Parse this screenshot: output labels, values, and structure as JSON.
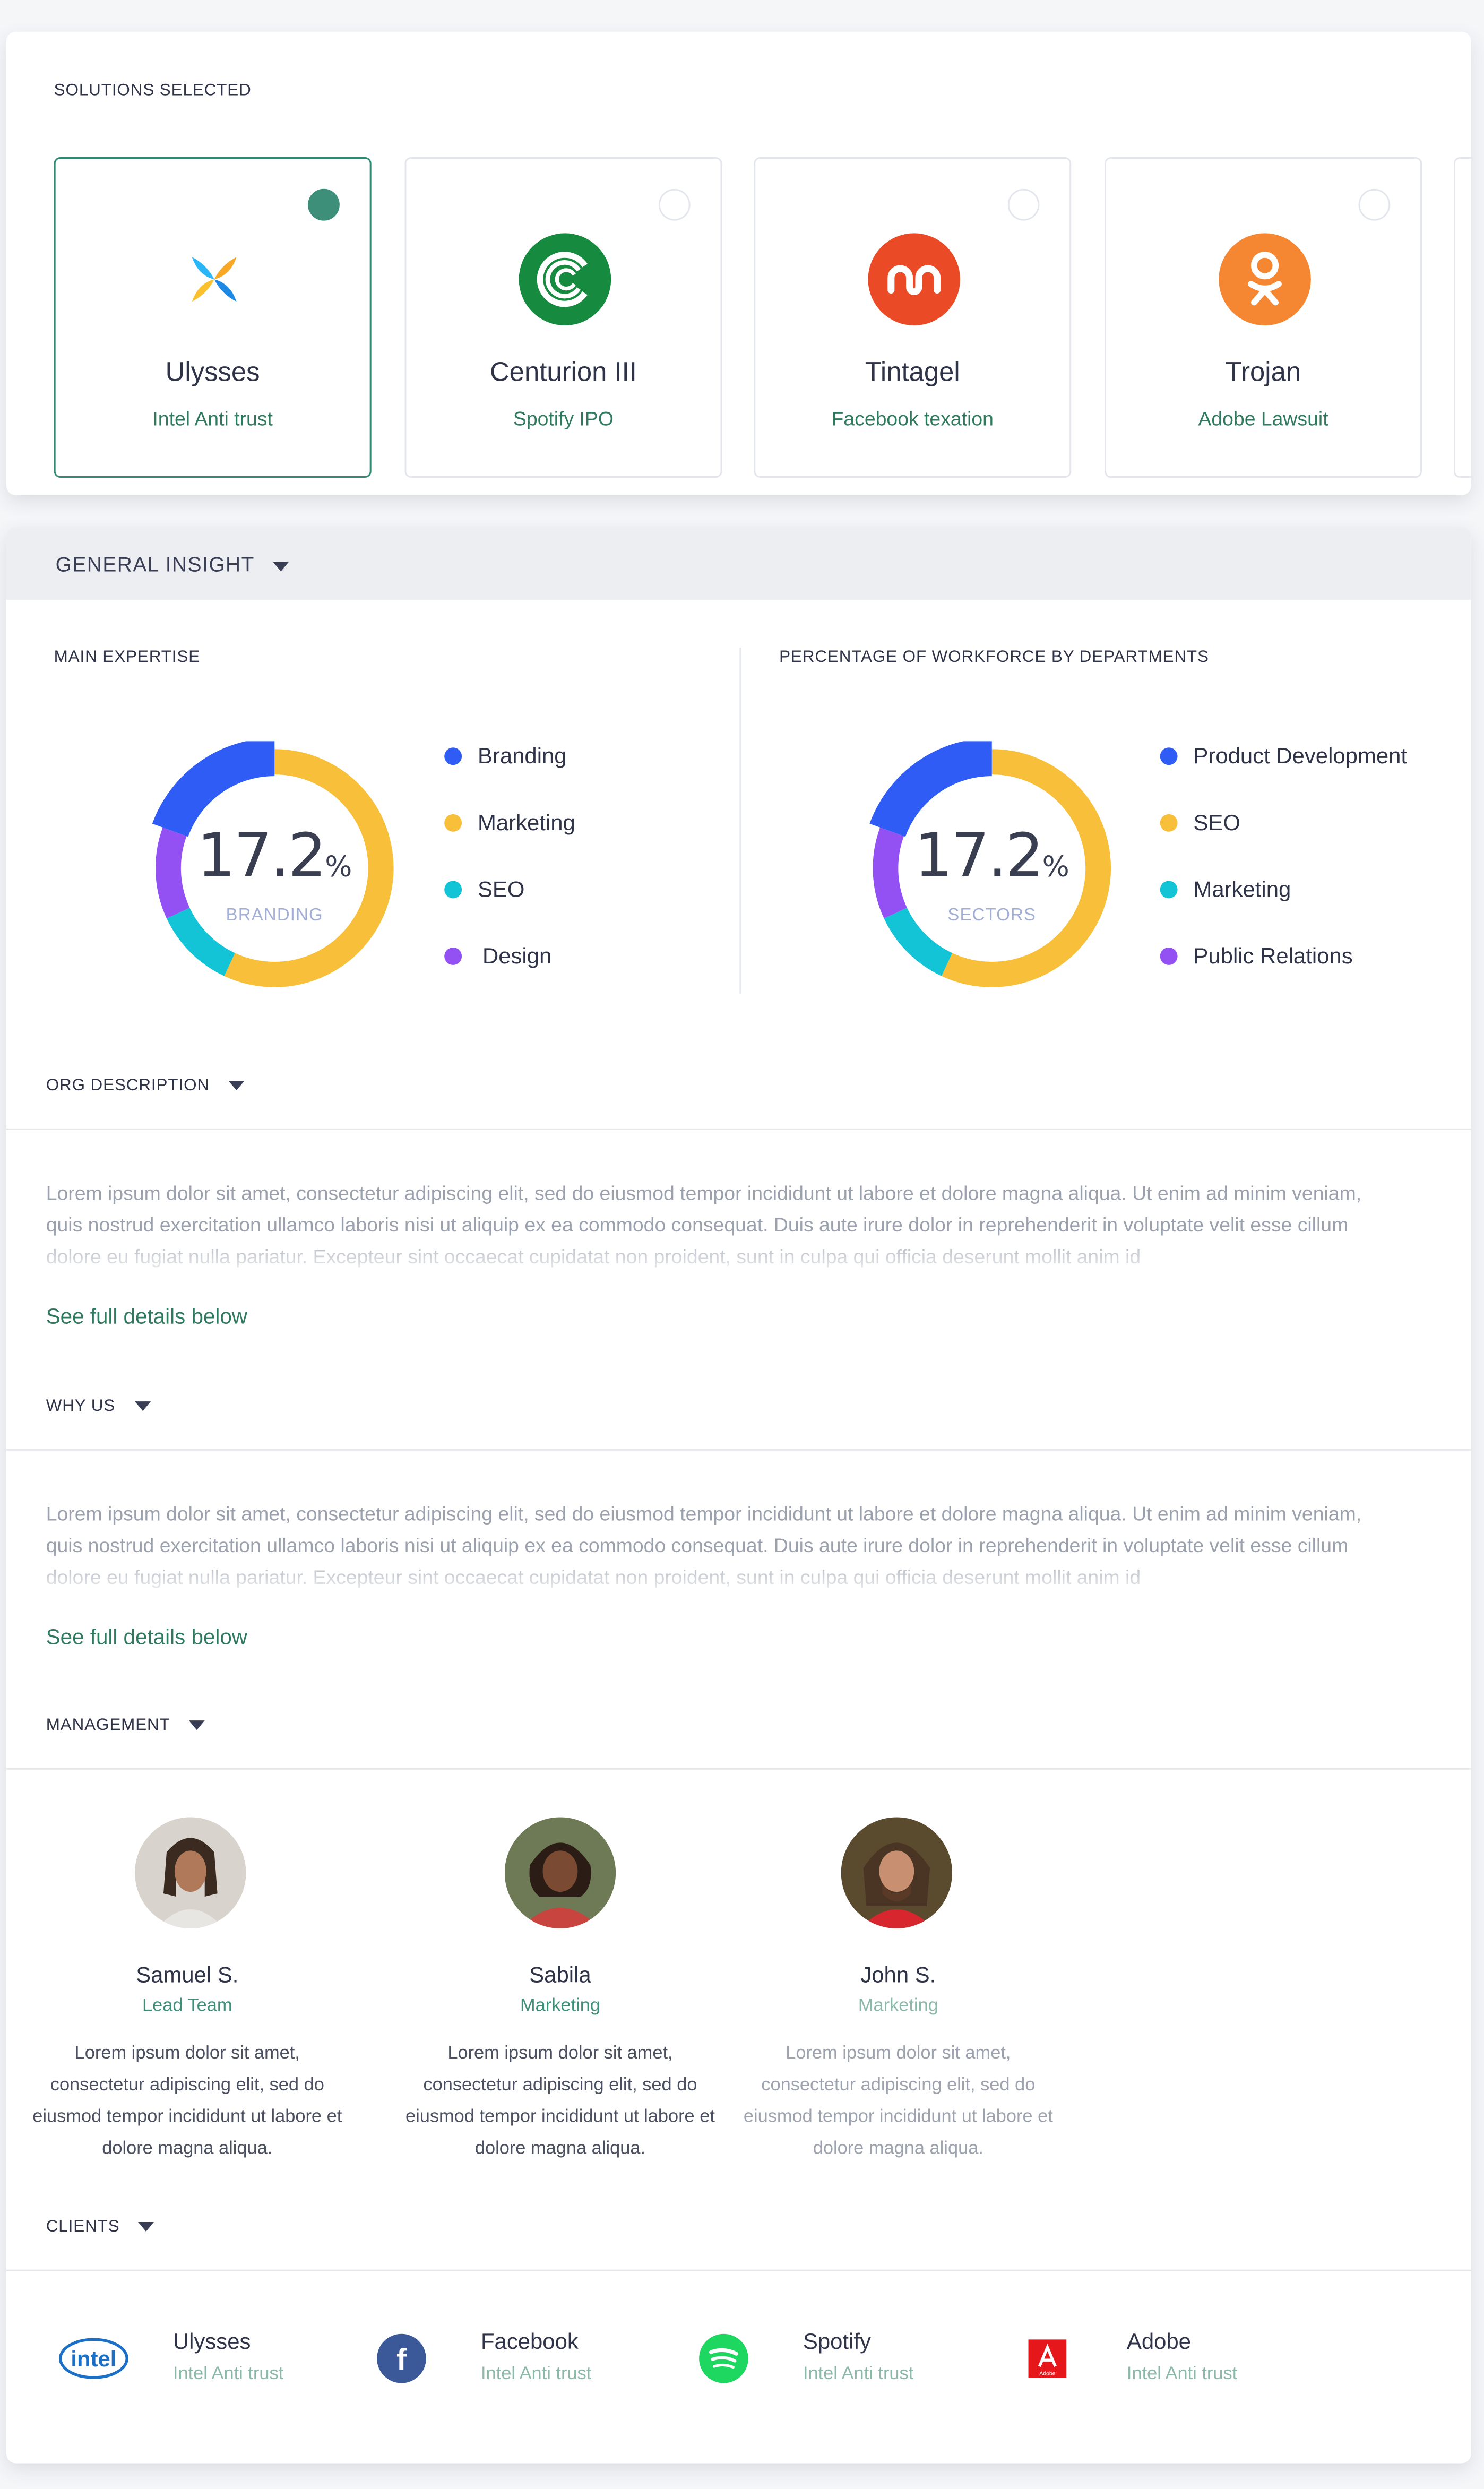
{
  "solutions": {
    "title": "SOLUTIONS SELECTED",
    "tiles": [
      {
        "name": "Ulysses",
        "sub": "Intel Anti trust",
        "selected": true,
        "icon": "pinwheel-icon"
      },
      {
        "name": "Centurion III",
        "sub": "Spotify IPO",
        "selected": false,
        "icon": "c-rings-icon"
      },
      {
        "name": "Tintagel",
        "sub": "Facebook texation",
        "selected": false,
        "icon": "stumbleupon-icon"
      },
      {
        "name": "Trojan",
        "sub": "Adobe Lawsuit",
        "selected": false,
        "icon": "odnoklassniki-icon"
      }
    ]
  },
  "general": {
    "title": "GENERAL INSIGHT"
  },
  "expertise": {
    "title": "MAIN EXPERTISE",
    "value": "17.2",
    "unit": "%",
    "caption": "BRANDING",
    "legend": [
      "Branding",
      "Marketing",
      "SEO",
      "Design"
    ]
  },
  "workforce": {
    "title": "PERCENTAGE OF WORKFORCE BY DEPARTMENTS",
    "value": "17.2",
    "unit": "%",
    "caption": "SECTORS",
    "legend": [
      "Product Development",
      "SEO",
      "Marketing",
      "Public Relations"
    ]
  },
  "colors": {
    "blue": "#2f5cf5",
    "yellow": "#f8c03a",
    "cyan": "#13c3d6",
    "purple": "#9350f2",
    "accent": "#2f7a5f"
  },
  "org": {
    "title": "ORG DESCRIPTION",
    "text": "Lorem ipsum dolor sit amet, consectetur adipiscing elit, sed do eiusmod tempor incididunt ut labore et dolore magna aliqua. Ut enim ad minim veniam, quis nostrud exercitation ullamco laboris nisi ut aliquip ex ea commodo consequat. Duis aute irure dolor in reprehenderit in voluptate velit esse cillum dolore eu fugiat nulla pariatur. Excepteur sint occaecat cupidatat non proident, sunt in culpa qui officia deserunt mollit anim id",
    "link": "See full details below"
  },
  "why": {
    "title": "WHY US",
    "text": "Lorem ipsum dolor sit amet, consectetur adipiscing elit, sed do eiusmod tempor incididunt ut labore et dolore magna aliqua. Ut enim ad minim veniam, quis nostrud exercitation ullamco laboris nisi ut aliquip ex ea commodo consequat. Duis aute irure dolor in reprehenderit in voluptate velit esse cillum dolore eu fugiat nulla pariatur. Excepteur sint occaecat cupidatat non proident, sunt in culpa qui officia deserunt mollit anim id",
    "link": "See full details below"
  },
  "management": {
    "title": "MANAGEMENT",
    "people": [
      {
        "name": "Samuel S.",
        "role": "Lead Team",
        "bio": "Lorem ipsum dolor sit amet, consectetur adipiscing elit, sed do eiusmod tempor incididunt ut labore et dolore magna aliqua."
      },
      {
        "name": "Sabila",
        "role": "Marketing",
        "bio": "Lorem ipsum dolor sit amet, consectetur adipiscing elit, sed do eiusmod tempor incididunt ut labore et dolore magna aliqua."
      },
      {
        "name": "John S.",
        "role": "Marketing",
        "bio": "Lorem ipsum dolor sit amet, consectetur adipiscing elit, sed do eiusmod tempor incididunt ut labore et dolore magna aliqua."
      }
    ]
  },
  "clients": {
    "title": "CLIENTS",
    "items": [
      {
        "name": "Ulysses",
        "sub": "Intel Anti trust",
        "logo_text": "intel",
        "icon": "intel-logo-icon"
      },
      {
        "name": "Facebook",
        "sub": "Intel Anti trust",
        "logo_text": "f",
        "icon": "facebook-icon"
      },
      {
        "name": "Spotify",
        "sub": "Intel Anti trust",
        "icon": "spotify-icon"
      },
      {
        "name": "Adobe",
        "sub": "Intel Anti trust",
        "logo_text": "Adobe",
        "icon": "adobe-icon"
      }
    ]
  }
}
